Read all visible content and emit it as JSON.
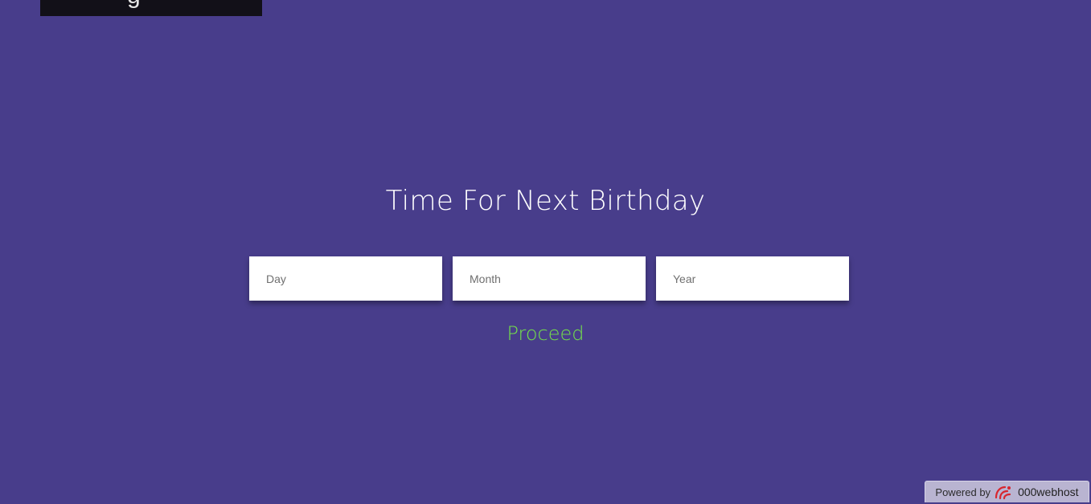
{
  "page": {
    "background_color": "#483d8b",
    "title": "Time For Next Birthday"
  },
  "form": {
    "day_placeholder": "Day",
    "month_placeholder": "Month",
    "year_placeholder": "Year",
    "proceed_label": "Proceed",
    "proceed_color": "#74e24a"
  },
  "footer": {
    "powered_by_label": "Powered by",
    "host_name": "000webhost",
    "host_icon": "000webhost-logo-icon"
  }
}
